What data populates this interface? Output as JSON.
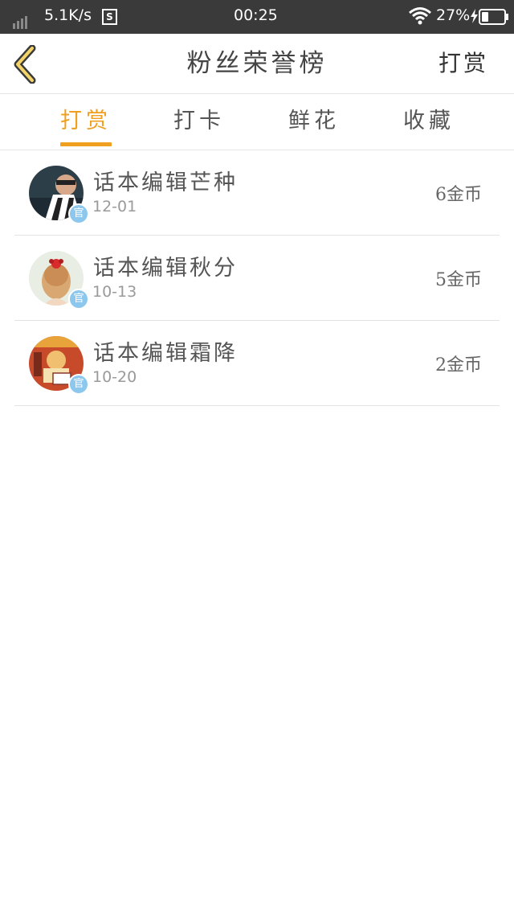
{
  "status_bar": {
    "net_speed": "5.1K/s",
    "s_icon_label": "S",
    "time": "00:25",
    "battery_percent": "27%",
    "icons": [
      "signal-icon",
      "s-app-icon",
      "wifi-icon",
      "charging-icon",
      "battery-icon"
    ]
  },
  "header": {
    "title": "粉丝荣誉榜",
    "action_label": "打赏",
    "back_icon": "chevron-left-icon",
    "accent_color": "#f0a020"
  },
  "tabs": [
    {
      "label": "打赏",
      "active": true
    },
    {
      "label": "打卡",
      "active": false
    },
    {
      "label": "鲜花",
      "active": false
    },
    {
      "label": "收藏",
      "active": false
    }
  ],
  "list": [
    {
      "name": "话本编辑芒种",
      "date": "12-01",
      "amount": "6金币",
      "badge": "官",
      "avatar_icon": "user-avatar-icon"
    },
    {
      "name": "话本编辑秋分",
      "date": "10-13",
      "amount": "5金币",
      "badge": "官",
      "avatar_icon": "user-avatar-icon"
    },
    {
      "name": "话本编辑霜降",
      "date": "10-20",
      "amount": "2金币",
      "badge": "官",
      "avatar_icon": "user-avatar-icon"
    }
  ]
}
